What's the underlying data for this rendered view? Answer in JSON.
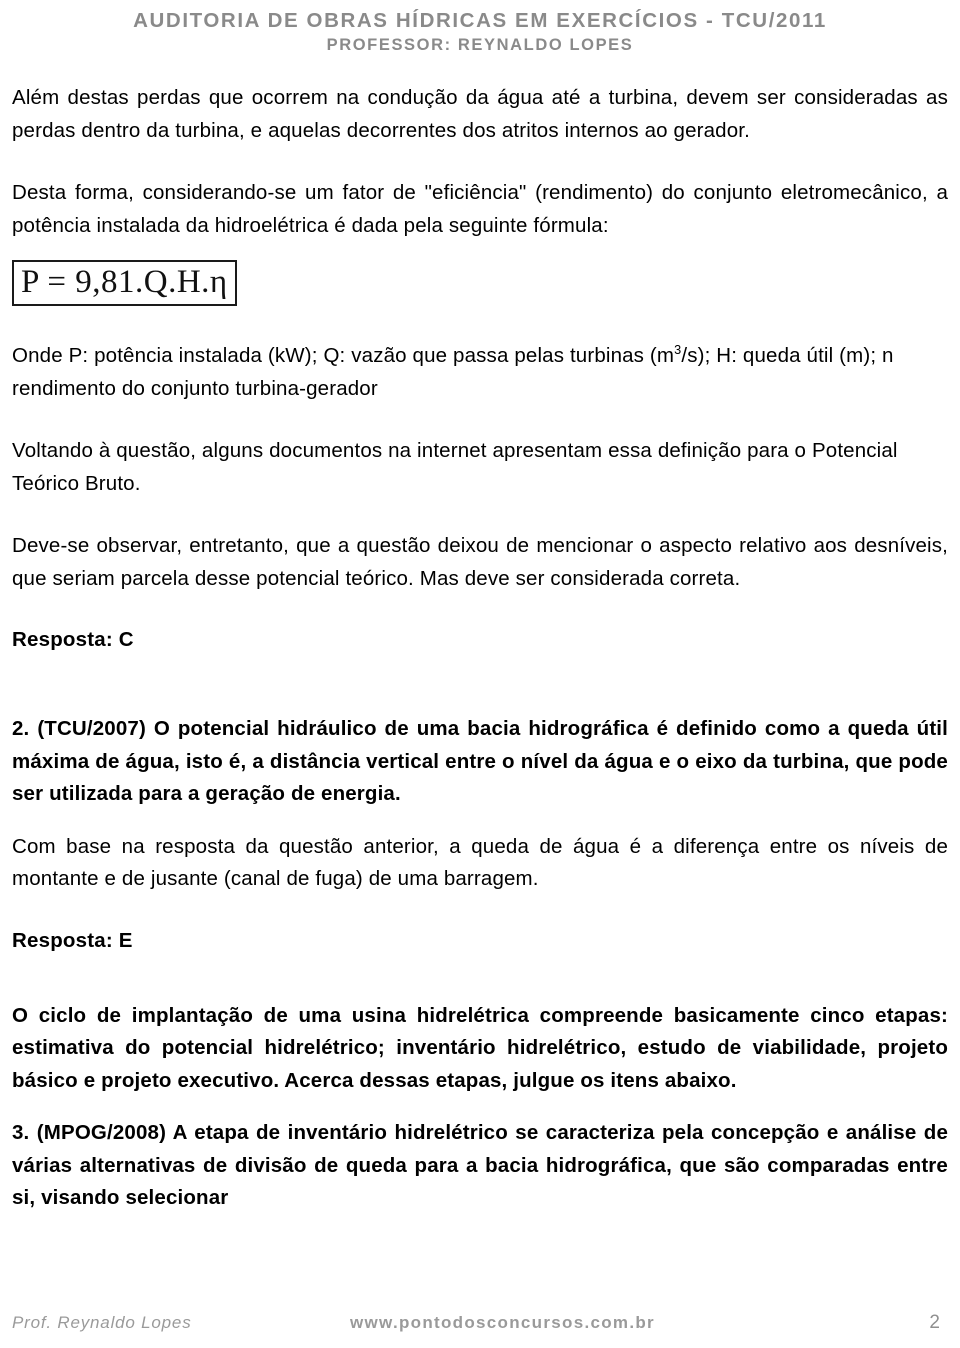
{
  "header": {
    "line1": "AUDITORIA DE OBRAS HÍDRICAS EM EXERCÍCIOS - TCU/2011",
    "line2": "PROFESSOR: REYNALDO LOPES"
  },
  "content": {
    "para_1": "Além destas perdas que ocorrem na condução da água até a turbina, devem ser consideradas as perdas dentro da turbina, e aquelas decorrentes dos atritos internos ao gerador.",
    "para_2": "Desta forma, considerando-se um fator de \"eficiência\" (rendimento) do conjunto eletromecânico, a potência instalada da hidroelétrica é dada pela seguinte fórmula:",
    "formula": "P = 9,81.Q.H.η",
    "para_3_pre": "Onde P: potência instalada (kW); Q: vazão que passa pelas turbinas (m",
    "para_3_sup": "3",
    "para_3_post": "/s); H: queda útil (m); n rendimento do conjunto turbina-gerador",
    "para_4": "Voltando à questão, alguns documentos na internet apresentam essa definição para o Potencial Teórico Bruto.",
    "para_5": "Deve-se observar, entretanto, que a questão deixou de mencionar o aspecto relativo aos desníveis, que seriam parcela desse potencial teórico. Mas deve ser considerada correta.",
    "answer_1": "Resposta: C",
    "question_2": "2. (TCU/2007) O potencial hidráulico de uma bacia hidrográfica é definido como a queda útil máxima de água, isto é, a distância vertical entre o nível da água e o eixo da turbina, que pode ser utilizada para a geração de energia.",
    "para_6": "Com base na resposta da questão anterior, a queda de água é a diferença entre os níveis de montante e de jusante (canal de fuga) de uma barragem.",
    "answer_2": "Resposta: E",
    "para_7": "O ciclo de implantação de uma usina hidrelétrica compreende basicamente cinco etapas: estimativa do potencial hidrelétrico; inventário hidrelétrico, estudo de viabilidade, projeto básico e projeto executivo. Acerca dessas etapas, julgue os itens abaixo.",
    "question_3": "3. (MPOG/2008) A etapa de inventário hidrelétrico se caracteriza pela concepção e análise de várias alternativas de divisão de queda para a bacia hidrográfica, que são comparadas entre si, visando selecionar"
  },
  "footer": {
    "author": "Prof. Reynaldo Lopes",
    "site": "www.pontodosconcursos.com.br",
    "page_number": "2"
  }
}
